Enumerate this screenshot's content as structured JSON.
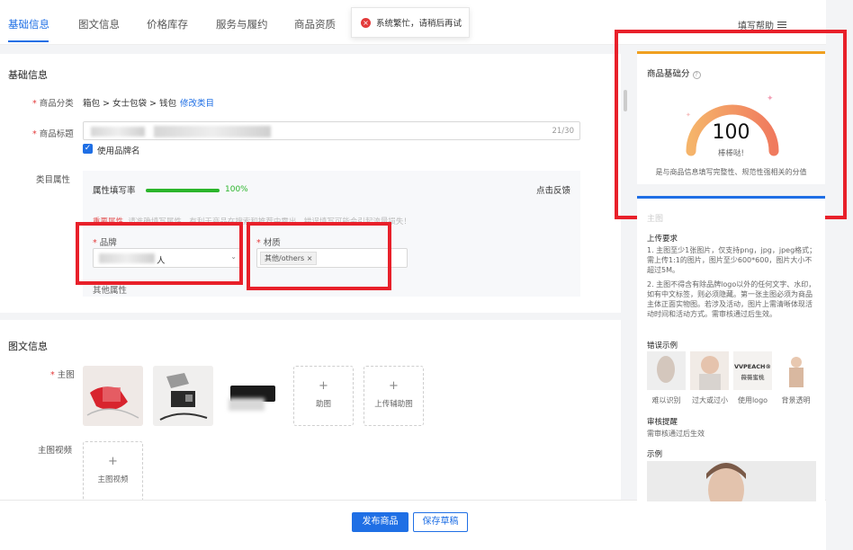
{
  "tabs": [
    "基础信息",
    "图文信息",
    "价格库存",
    "服务与履约",
    "商品资质"
  ],
  "toast": {
    "message": "系统繁忙，请稍后再试"
  },
  "header": {
    "help": "填写帮助"
  },
  "basic": {
    "section_title": "基础信息",
    "category_label": "商品分类",
    "category_value": "箱包 > 女士包袋 > 钱包",
    "category_link": "修改类目",
    "title_label": "商品标题",
    "title_counter": "21/30",
    "brand_checkbox": "使用品牌名",
    "attr_label": "类目属性",
    "fill_rate_label": "属性填写率",
    "fill_rate_value": "100%",
    "fill_rate": 1.0,
    "feedback": "点击反馈",
    "important_label": "重要属性",
    "important_hint": "请准确填写属性，有利于商品在搜索和推荐中露出，错误填写可能会引起流量损失！",
    "brand_label": "品牌",
    "brand_value_suffix": "人",
    "material_label": "材质",
    "material_tag": "其他/others",
    "other_attrs": "其他属性"
  },
  "media": {
    "section_title": "图文信息",
    "main_image_label": "主图",
    "upload_aux_partial": "助图",
    "upload_aux": "上传辅助图",
    "video_label": "主图视频",
    "upload_video": "主图视频"
  },
  "footer": {
    "publish": "发布商品",
    "save_draft": "保存草稿"
  },
  "score": {
    "title": "商品基础分",
    "value": "100",
    "praise": "棒棒哒!",
    "desc": "是与商品信息填写完整性、规范性强相关的分值",
    "gauge_fraction": 1.0
  },
  "rules": {
    "title": "主图",
    "upload_req_title": "上传要求",
    "req1": "1. 主图至少1张图片，仅支持png，jpg，jpeg格式；需上传1:1的图片，图片至少600*600，图片大小不超过5M。",
    "req2": "2. 主图不得含有除品牌logo以外的任何文字、水印，如有中文标签，则必须隐藏。第一张主图必须为商品主体正面实物图。若涉及活动，图片上需清晰体现活动时间和活动方式。需审核通过后生效。",
    "wrong_examples_title": "错误示例",
    "wrong_examples": [
      "难以识别",
      "过大或过小",
      "使用logo",
      "背景透明"
    ],
    "audit_title": "审核提醒",
    "audit_text": "需审核通过后生效",
    "example_title": "示例",
    "logo_text_1": "VVPEACH®",
    "logo_text_2": "薇薇蜜桃"
  },
  "colors": {
    "primary": "#1f6fe5",
    "error": "#e8202a",
    "success": "#2bb52b",
    "score_accent": "#f0a020"
  }
}
